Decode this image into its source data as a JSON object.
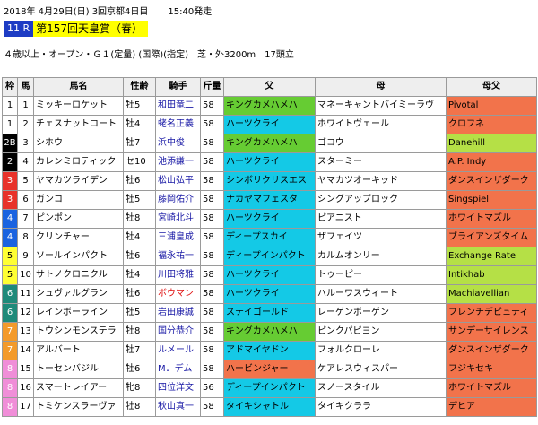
{
  "header": {
    "line1": "2018年 4月29日(日) 3回京都4日目",
    "start_time": "15:40発走",
    "race_number": "11 R",
    "race_name": "第157回天皇賞（春）",
    "conditions": "４歳以上・オープン・Ｇ１(定量) (国際)(指定)　芝・外3200m　17頭立"
  },
  "columns": [
    "枠",
    "馬",
    "馬名",
    "性齢",
    "騎手",
    "斤量",
    "父",
    "母",
    "母父"
  ],
  "colors": {
    "waku": {
      "1": "#ffffff",
      "2": "#000000",
      "3": "#e8322a",
      "4": "#1a63e0",
      "5": "#ffff33",
      "6": "#1f8a7a",
      "7": "#f39a2b",
      "8": "#f08ed8"
    },
    "waku_text": {
      "1": "#000000",
      "2": "#ffffff",
      "3": "#ffffff",
      "4": "#ffffff",
      "5": "#000000",
      "6": "#ffffff",
      "7": "#ffffff",
      "8": "#ffffff"
    },
    "sire_bg": {
      "キングカメハメハ": "#66cc33",
      "ハーツクライ": "#14c9e6",
      "シンボリクリスエス": "#14c9e6",
      "ナカヤマフェスタ": "#14c9e6",
      "ディープスカイ": "#14c9e6",
      "ディープインパクト": "#14c9e6",
      "ステイゴールド": "#14c9e6",
      "アドマイヤドン": "#14c9e6",
      "ハービンジャー": "#f2734b",
      "タイキシャトル": "#14c9e6"
    },
    "bms_bg_red": "#f2734b",
    "bms_bg_green": "#b5e046"
  },
  "rows": [
    {
      "waku": "1",
      "num": "1",
      "name": "ミッキーロケット",
      "sex": "牡5",
      "jockey": "和田竜二",
      "jred": false,
      "weight": "58",
      "sire": "キングカメハメハ",
      "dam": "マネーキャントバイミーラヴ",
      "bms": "Pivotal",
      "bmsc": "red"
    },
    {
      "waku": "1",
      "num": "2",
      "name": "チェスナットコート",
      "sex": "牡4",
      "jockey": "蛯名正義",
      "jred": false,
      "weight": "58",
      "sire": "ハーツクライ",
      "dam": "ホワイトヴェール",
      "bms": "クロフネ",
      "bmsc": "red"
    },
    {
      "waku": "2B",
      "num": "3",
      "name": "シホウ",
      "sex": "牡7",
      "jockey": "浜中俊",
      "jred": false,
      "weight": "58",
      "sire": "キングカメハメハ",
      "dam": "ゴコウ",
      "bms": "Danehill",
      "bmsc": "green"
    },
    {
      "waku": "2",
      "num": "4",
      "name": "カレンミロティック",
      "sex": "セ10",
      "jockey": "池添謙一",
      "jred": false,
      "weight": "58",
      "sire": "ハーツクライ",
      "dam": "スターミー",
      "bms": "A.P. Indy",
      "bmsc": "red"
    },
    {
      "waku": "3",
      "num": "5",
      "name": "ヤマカツライデン",
      "sex": "牡6",
      "jockey": "松山弘平",
      "jred": false,
      "weight": "58",
      "sire": "シンボリクリスエス",
      "dam": "ヤマカツオーキッド",
      "bms": "ダンスインザダーク",
      "bmsc": "red"
    },
    {
      "waku": "3",
      "num": "6",
      "name": "ガンコ",
      "sex": "牡5",
      "jockey": "藤岡佑介",
      "jred": false,
      "weight": "58",
      "sire": "ナカヤマフェスタ",
      "dam": "シングアップロック",
      "bms": "Singspiel",
      "bmsc": "red"
    },
    {
      "waku": "4",
      "num": "7",
      "name": "ピンポン",
      "sex": "牡8",
      "jockey": "宮崎北斗",
      "jred": false,
      "weight": "58",
      "sire": "ハーツクライ",
      "dam": "ピアニスト",
      "bms": "ホワイトマズル",
      "bmsc": "red"
    },
    {
      "waku": "4",
      "num": "8",
      "name": "クリンチャー",
      "sex": "牡4",
      "jockey": "三浦皇成",
      "jred": false,
      "weight": "58",
      "sire": "ディープスカイ",
      "dam": "ザフェイツ",
      "bms": "ブライアンズタイム",
      "bmsc": "red"
    },
    {
      "waku": "5",
      "num": "9",
      "name": "ソールインパクト",
      "sex": "牡6",
      "jockey": "福永祐一",
      "jred": false,
      "weight": "58",
      "sire": "ディープインパクト",
      "dam": "カルムオンリー",
      "bms": "Exchange Rate",
      "bmsc": "green"
    },
    {
      "waku": "5",
      "num": "10",
      "name": "サトノクロニクル",
      "sex": "牡4",
      "jockey": "川田将雅",
      "jred": false,
      "weight": "58",
      "sire": "ハーツクライ",
      "dam": "トゥーピー",
      "bms": "Intikhab",
      "bmsc": "green"
    },
    {
      "waku": "6",
      "num": "11",
      "name": "シュヴァルグラン",
      "sex": "牡6",
      "jockey": "ボウマン",
      "jred": true,
      "weight": "58",
      "sire": "ハーツクライ",
      "dam": "ハルーワスウィート",
      "bms": "Machiavellian",
      "bmsc": "green"
    },
    {
      "waku": "6",
      "num": "12",
      "name": "レインボーライン",
      "sex": "牡5",
      "jockey": "岩田康誠",
      "jred": false,
      "weight": "58",
      "sire": "ステイゴールド",
      "dam": "レーゲンボーゲン",
      "bms": "フレンチデピュティ",
      "bmsc": "red"
    },
    {
      "waku": "7",
      "num": "13",
      "name": "トウシンモンステラ",
      "sex": "牡8",
      "jockey": "国分恭介",
      "jred": false,
      "weight": "58",
      "sire": "キングカメハメハ",
      "dam": "ピンクパピヨン",
      "bms": "サンデーサイレンス",
      "bmsc": "red"
    },
    {
      "waku": "7",
      "num": "14",
      "name": "アルバート",
      "sex": "牡7",
      "jockey": "ルメール",
      "jred": false,
      "weight": "58",
      "sire": "アドマイヤドン",
      "dam": "フォルクローレ",
      "bms": "ダンスインザダーク",
      "bmsc": "red"
    },
    {
      "waku": "8",
      "num": "15",
      "name": "トーセンバジル",
      "sex": "牡6",
      "jockey": "M．デム",
      "jred": false,
      "weight": "58",
      "sire": "ハービンジャー",
      "dam": "ケアレスウィスパー",
      "bms": "フジキセキ",
      "bmsc": "red"
    },
    {
      "waku": "8",
      "num": "16",
      "name": "スマートレイアー",
      "sex": "牝8",
      "jockey": "四位洋文",
      "jred": false,
      "weight": "56",
      "sire": "ディープインパクト",
      "dam": "スノースタイル",
      "bms": "ホワイトマズル",
      "bmsc": "red"
    },
    {
      "waku": "8",
      "num": "17",
      "name": "トミケンスラーヴァ",
      "sex": "牡8",
      "jockey": "秋山真一",
      "jred": false,
      "weight": "58",
      "sire": "タイキシャトル",
      "dam": "タイキクララ",
      "bms": "デヒア",
      "bmsc": "red"
    }
  ]
}
